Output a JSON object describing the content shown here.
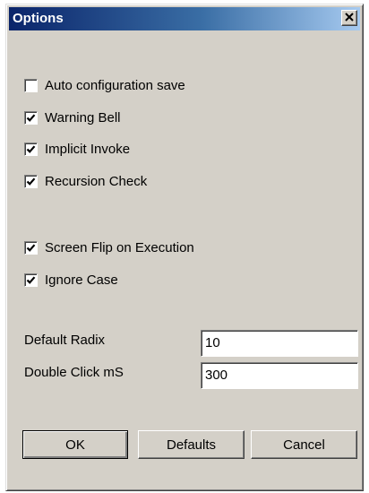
{
  "dialog": {
    "title": "Options",
    "close_icon": "close-icon"
  },
  "checkboxes": {
    "auto_config_save": {
      "label": "Auto configuration save",
      "checked": false
    },
    "warning_bell": {
      "label": "Warning Bell",
      "checked": true
    },
    "implicit_invoke": {
      "label": "Implicit Invoke",
      "checked": true
    },
    "recursion_check": {
      "label": "Recursion Check",
      "checked": true
    },
    "screen_flip": {
      "label": "Screen Flip on Execution",
      "checked": true
    },
    "ignore_case": {
      "label": "Ignore Case",
      "checked": true
    }
  },
  "fields": {
    "default_radix": {
      "label": "Default Radix",
      "value": "10"
    },
    "double_click": {
      "label": "Double Click mS",
      "value": "300"
    }
  },
  "buttons": {
    "ok": "OK",
    "defaults": "Defaults",
    "cancel": "Cancel"
  }
}
